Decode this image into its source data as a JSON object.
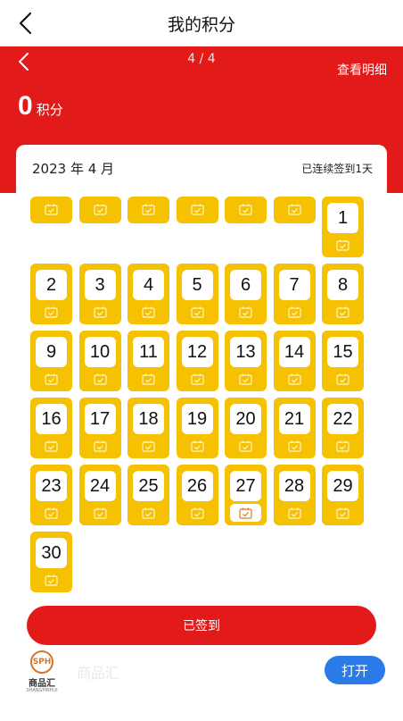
{
  "header": {
    "title": "我的积分"
  },
  "banner": {
    "pager": "4 / 4",
    "detail_link": "查看明细",
    "points_value": "0",
    "points_unit": "积分"
  },
  "calendar": {
    "month_label": "2023 年 4 月",
    "streak_label": "已连续签到1天",
    "leading_blank_days": 6,
    "today": 27,
    "days": [
      "1",
      "2",
      "3",
      "4",
      "5",
      "6",
      "7",
      "8",
      "9",
      "10",
      "11",
      "12",
      "13",
      "14",
      "15",
      "16",
      "17",
      "18",
      "19",
      "20",
      "21",
      "22",
      "23",
      "24",
      "25",
      "26",
      "27",
      "28",
      "29",
      "30"
    ]
  },
  "actions": {
    "signed_label": "已签到"
  },
  "app_banner": {
    "logo_text": "SPH",
    "logo_name": "商品汇",
    "logo_sub": "SHANGPINHUI",
    "app_name": "商品汇",
    "open_label": "打开"
  },
  "colors": {
    "primary_red": "#e31a1a",
    "cell_yellow": "#f5c100",
    "open_blue": "#2a7be8",
    "today_icon": "#e8791f"
  },
  "icons": {
    "back": "chevron-left-icon",
    "day_marker": "calendar-check-icon"
  }
}
